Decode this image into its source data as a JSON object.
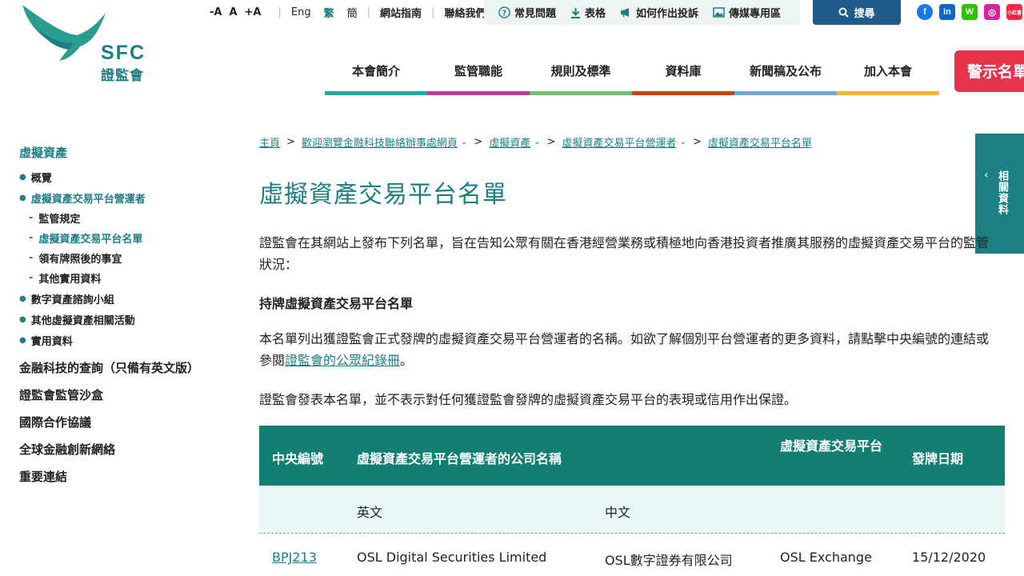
{
  "header": {
    "logo_text": "SFC",
    "logo_subtext": "證監會",
    "font_sizes": [
      "-A",
      "A",
      "+A"
    ],
    "languages": [
      {
        "label": "Eng",
        "active": false
      },
      {
        "label": "繁",
        "active": true
      },
      {
        "label": "簡",
        "active": false
      }
    ],
    "util_links": [
      "網站指南",
      "聯絡我們"
    ],
    "quick_links": [
      {
        "label": "常見問題",
        "icon": "question-circle-icon"
      },
      {
        "label": "表格",
        "icon": "download-icon"
      },
      {
        "label": "如何作出投訴",
        "icon": "megaphone-icon"
      },
      {
        "label": "傳媒專用區",
        "icon": "image-icon"
      }
    ],
    "search_label": "搜尋",
    "social": [
      {
        "name": "facebook-icon",
        "glyph": "f"
      },
      {
        "name": "linkedin-icon",
        "glyph": "in"
      },
      {
        "name": "wechat-icon",
        "glyph": "W"
      },
      {
        "name": "instagram-icon",
        "glyph": "◎"
      },
      {
        "name": "xiaohongshu-icon",
        "glyph": "小紅書"
      }
    ],
    "nav": [
      {
        "label": "本會簡介",
        "color": "#2aa8a0"
      },
      {
        "label": "監管職能",
        "color": "#b0409a"
      },
      {
        "label": "規則及標準",
        "color": "#6cc070"
      },
      {
        "label": "資料庫",
        "color": "#c84418"
      },
      {
        "label": "新聞稿及公布",
        "color": "#6fa8d8"
      },
      {
        "label": "加入本會",
        "color": "#f2b830"
      }
    ],
    "alert_label": "警示名單"
  },
  "side_tab": {
    "label": "相關資料"
  },
  "sidebar": {
    "title": "虛擬資產",
    "items": [
      {
        "label": "概覽",
        "level": 1,
        "active": false
      },
      {
        "label": "虛擬資產交易平台營運者",
        "level": 1,
        "active": true
      },
      {
        "label": "監管規定",
        "level": 2,
        "active": false
      },
      {
        "label": "虛擬資產交易平台名單",
        "level": 2,
        "active": true
      },
      {
        "label": "領有牌照後的事宜",
        "level": 2,
        "active": false
      },
      {
        "label": "其他實用資料",
        "level": 2,
        "active": false
      },
      {
        "label": "數字資產諮詢小組",
        "level": 1,
        "active": false
      },
      {
        "label": "其他虛擬資產相關活動",
        "level": 1,
        "active": false
      },
      {
        "label": "實用資料",
        "level": 1,
        "active": false
      }
    ],
    "top_items": [
      "金融科技的查詢（只備有英文版）",
      "證監會監管沙盒",
      "國際合作協議",
      "全球金融創新網絡",
      "重要連結"
    ]
  },
  "breadcrumb": [
    {
      "label": "主頁",
      "dropdown": false
    },
    {
      "label": "歡迎瀏覽金融科技聯絡辦事處網頁",
      "dropdown": true
    },
    {
      "label": "虛擬資產",
      "dropdown": true
    },
    {
      "label": "虛擬資產交易平台營運者",
      "dropdown": true
    },
    {
      "label": "虛擬資產交易平台名單",
      "dropdown": false
    }
  ],
  "content": {
    "title": "虛擬資產交易平台名單",
    "intro": "證監會在其網站上發布下列名單，旨在告知公眾有關在香港經營業務或積極地向香港投資者推廣其服務的虛擬資產交易平台的監管狀況：",
    "section_heading": "持牌虛擬資產交易平台名單",
    "section_text_before": "本名單列出獲證監會正式發牌的虛擬資產交易平台營運者的名稱。如欲了解個別平台營運者的更多資料，請點擊中央編號的連結或參閱",
    "section_link": "證監會的公眾紀錄冊",
    "section_text_after": "。",
    "disclaimer": "證監會發表本名單，並不表示對任何獲證監會發牌的虛擬資產交易平台的表現或信用作出保證。"
  },
  "table": {
    "headers": {
      "ce": "中央編號",
      "company": "虛擬資產交易平台營運者的公司名稱",
      "platform": "虛擬資產交易平台",
      "date": "發牌日期"
    },
    "sub_headers": {
      "en": "英文",
      "zh": "中文"
    },
    "rows": [
      {
        "ce": "BPJ213",
        "name_en": "OSL Digital Securities Limited",
        "name_zh": "OSL數字證券有限公司",
        "platform": "OSL Exchange",
        "date": "15/12/2020"
      }
    ]
  }
}
